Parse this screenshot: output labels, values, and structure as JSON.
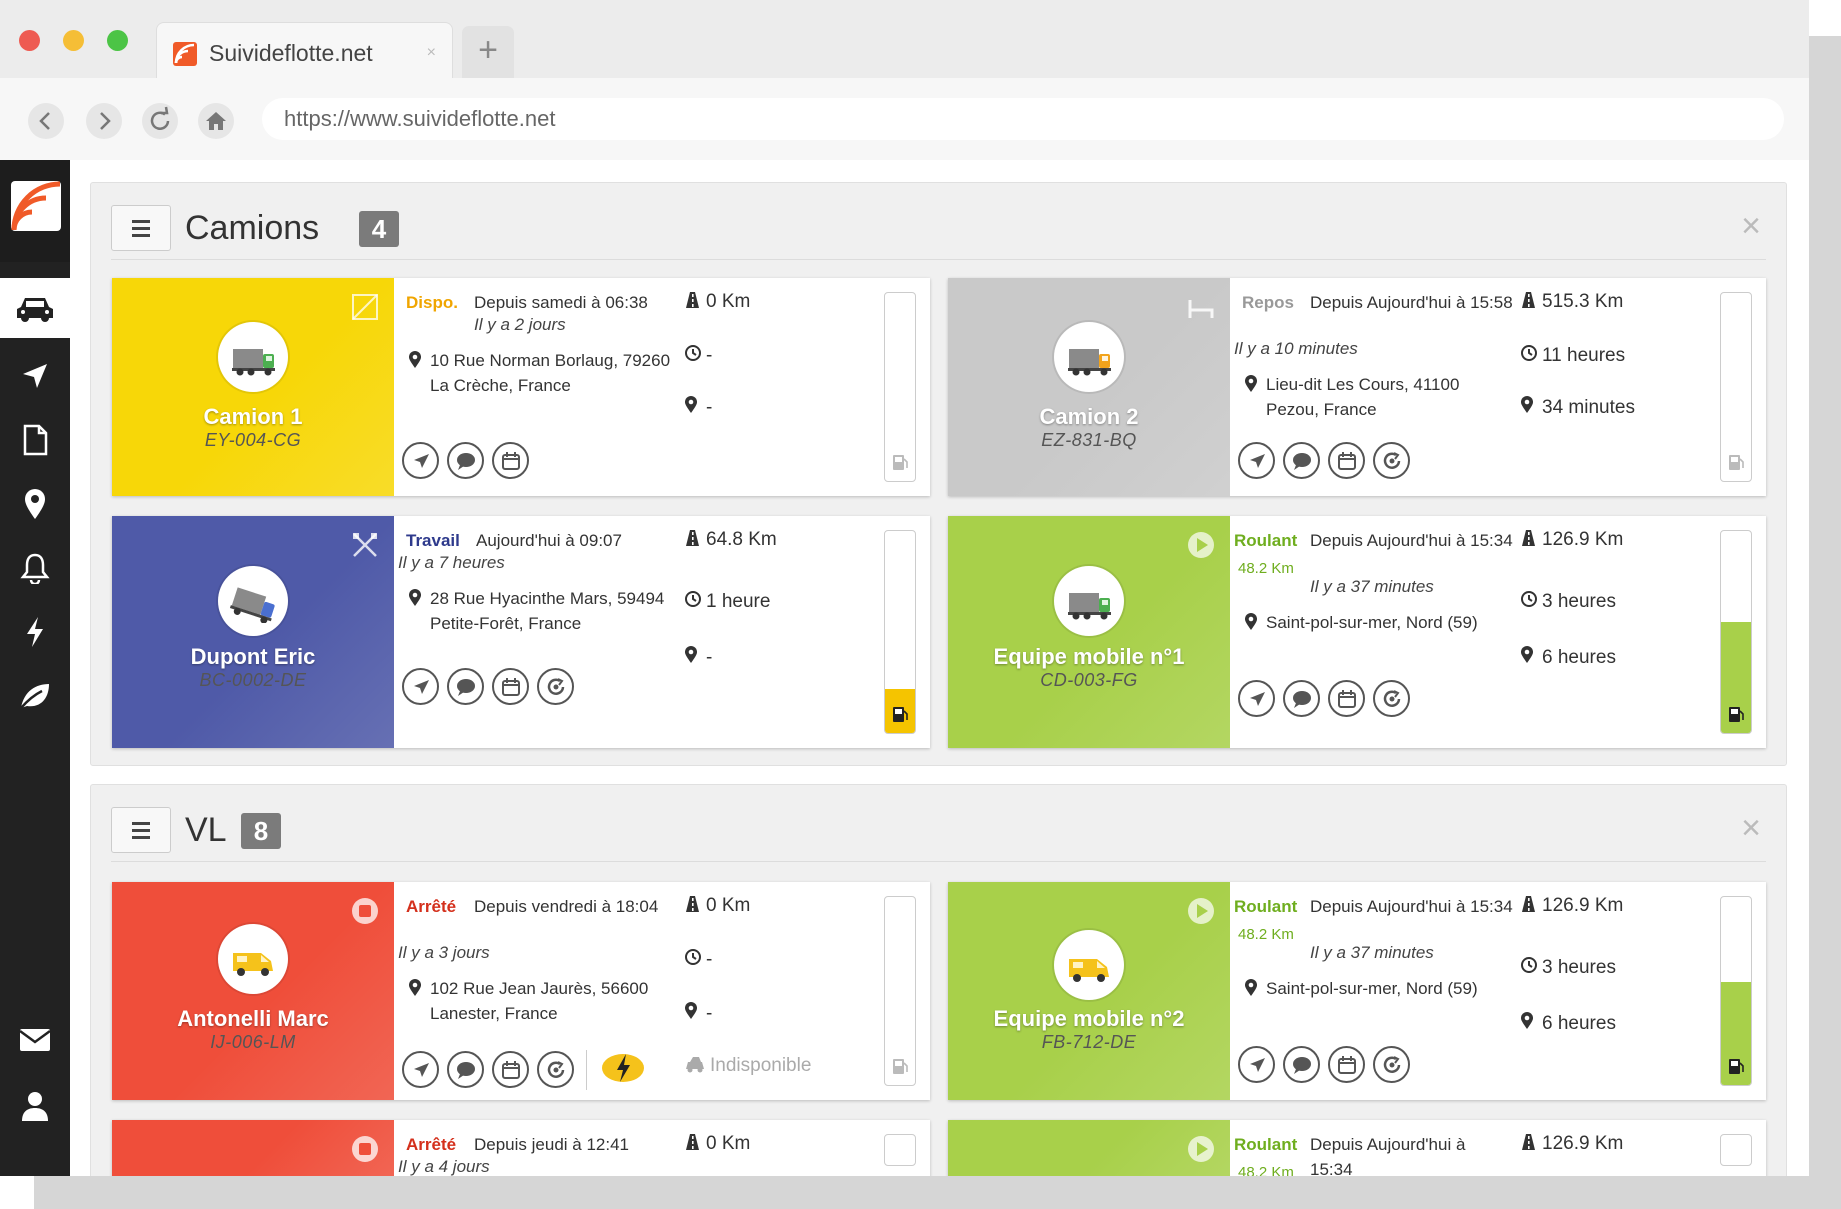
{
  "browser": {
    "tab_title": "Suivideflotte.net",
    "tab_close": "×",
    "new_tab": "+",
    "url": "https://www.suivideflotte.net"
  },
  "sidebar": {
    "items": [
      "car-icon",
      "navigation-arrow-icon",
      "document-icon",
      "map-pin-icon",
      "bell-icon",
      "lightning-icon",
      "leaf-icon"
    ],
    "bottom": [
      "envelope-icon",
      "user-icon"
    ]
  },
  "groups": [
    {
      "title": "Camions",
      "count": "4",
      "cards": [
        {
          "name": "Camion 1",
          "plate": "EY-004-CG",
          "color": "#f7d708",
          "status": "Dispo.",
          "status_color": "#f0a500",
          "since": "Depuis samedi à 06:38",
          "ago": "Il y a 2 jours",
          "address": "10 Rue Norman Borlaug, 79260 La Crèche, France",
          "km": "0 Km",
          "duration": "-",
          "pin_value": "-",
          "fuel": 0,
          "vehicle": "truck-green",
          "corner_icon": "parking-square-icon"
        },
        {
          "name": "Camion 2",
          "plate": "EZ-831-BQ",
          "color": "#c9c9c9",
          "status": "Repos",
          "status_color": "#999999",
          "since": "Depuis Aujourd'hui à 15:58",
          "ago": "Il y a 10 minutes",
          "address": "Lieu-dit Les Cours, 41100 Pezou, France",
          "km": "515.3 Km",
          "duration": "11 heures",
          "pin_value": "34 minutes",
          "fuel": 0,
          "vehicle": "truck-orange",
          "corner_icon": "bed-icon"
        },
        {
          "name": "Dupont Eric",
          "plate": "BC-0002-DE",
          "color": "#4f5aa8",
          "status": "Travail",
          "status_color": "#2e3a8c",
          "since": "Aujourd'hui à 09:07",
          "ago": "Il y a 7 heures",
          "address": "28 Rue Hyacinthe Mars, 59494 Petite-Forêt, France",
          "km": "64.8 Km",
          "duration": "1 heure",
          "pin_value": "-",
          "fuel": 0.22,
          "fuel_color": "#f5c400",
          "vehicle": "truck-blue",
          "corner_icon": "tools-icon"
        },
        {
          "name": "Equipe mobile n°1",
          "plate": "CD-003-FG",
          "color": "#a8d04a",
          "status": "Roulant",
          "status_color": "#6fae1f",
          "speed": "48.2 Km",
          "since": "Depuis Aujourd'hui à 15:34",
          "ago": "Il y a 37 minutes",
          "address": "Saint-pol-sur-mer, Nord (59)",
          "km": "126.9 Km",
          "duration": "3 heures",
          "pin_value": "6 heures",
          "fuel": 0.55,
          "fuel_color": "#a8d04a",
          "vehicle": "truck-green",
          "corner_icon": "play-icon"
        }
      ]
    },
    {
      "title": "VL",
      "count": "8",
      "cards": [
        {
          "name": "Antonelli Marc",
          "plate": "IJ-006-LM",
          "color": "#ef4e3a",
          "status": "Arrêté",
          "status_color": "#d4301c",
          "since": "Depuis vendredi à 18:04",
          "ago": "Il y a 3 jours",
          "address": "102 Rue Jean Jaurès, 56600 Lanester, France",
          "km": "0 Km",
          "duration": "-",
          "pin_value": "-",
          "extra": "Indisponible",
          "fuel": 0,
          "vehicle": "van-yellow",
          "corner_icon": "stop-icon"
        },
        {
          "name": "Equipe mobile n°2",
          "plate": "FB-712-DE",
          "color": "#a8d04a",
          "status": "Roulant",
          "status_color": "#6fae1f",
          "speed": "48.2 Km",
          "since": "Depuis Aujourd'hui à 15:34",
          "ago": "Il y a 37 minutes",
          "address": "Saint-pol-sur-mer, Nord (59)",
          "km": "126.9 Km",
          "duration": "3 heures",
          "pin_value": "6 heures",
          "fuel": 0.55,
          "fuel_color": "#a8d04a",
          "vehicle": "van-yellow",
          "corner_icon": "play-icon"
        },
        {
          "name": "",
          "plate": "",
          "color": "#ef4e3a",
          "status": "Arrêté",
          "status_color": "#d4301c",
          "since": "Depuis jeudi à 12:41",
          "ago": "Il y a 4 jours",
          "km": "0 Km",
          "corner_icon": "stop-icon"
        },
        {
          "name": "",
          "plate": "",
          "color": "#a8d04a",
          "status": "Roulant",
          "status_color": "#6fae1f",
          "speed": "48.2 Km",
          "since": "Depuis Aujourd'hui à",
          "since2": "15:34",
          "km": "126.9 Km",
          "corner_icon": "play-icon"
        }
      ]
    }
  ]
}
